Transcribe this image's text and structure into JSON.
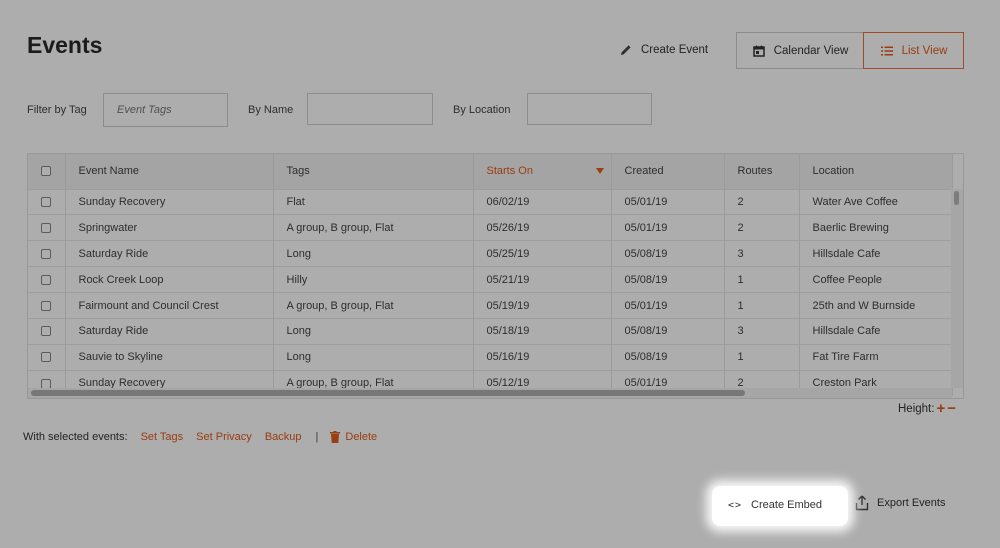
{
  "header": {
    "title": "Events",
    "create_event_label": "Create Event",
    "views": {
      "calendar_label": "Calendar View",
      "list_label": "List View",
      "active": "list"
    }
  },
  "filters": {
    "tag_label": "Filter by Tag",
    "tag_placeholder": "Event Tags",
    "name_label": "By Name",
    "name_value": "",
    "location_label": "By Location",
    "location_value": ""
  },
  "table": {
    "columns": [
      "Event Name",
      "Tags",
      "Starts On",
      "Created",
      "Routes",
      "Location"
    ],
    "sorted_column": "Starts On",
    "rows": [
      {
        "name": "Sunday Recovery",
        "tags": "Flat",
        "starts": "06/02/19",
        "created": "05/01/19",
        "routes": "2",
        "location": "Water Ave Coffee"
      },
      {
        "name": "Springwater",
        "tags": "A group, B group, Flat",
        "starts": "05/26/19",
        "created": "05/01/19",
        "routes": "2",
        "location": "Baerlic Brewing"
      },
      {
        "name": "Saturday Ride",
        "tags": "Long",
        "starts": "05/25/19",
        "created": "05/08/19",
        "routes": "3",
        "location": "Hillsdale Cafe"
      },
      {
        "name": "Rock Creek Loop",
        "tags": "Hilly",
        "starts": "05/21/19",
        "created": "05/08/19",
        "routes": "1",
        "location": "Coffee People"
      },
      {
        "name": "Fairmount and Council Crest",
        "tags": "A group, B group, Flat",
        "starts": "05/19/19",
        "created": "05/01/19",
        "routes": "1",
        "location": "25th and W Burnside"
      },
      {
        "name": "Saturday Ride",
        "tags": "Long",
        "starts": "05/18/19",
        "created": "05/08/19",
        "routes": "3",
        "location": "Hillsdale Cafe"
      },
      {
        "name": "Sauvie to Skyline",
        "tags": "Long",
        "starts": "05/16/19",
        "created": "05/08/19",
        "routes": "1",
        "location": "Fat Tire Farm"
      },
      {
        "name": "Sunday Recovery",
        "tags": "A group, B group, Flat",
        "starts": "05/12/19",
        "created": "05/01/19",
        "routes": "2",
        "location": "Creston Park"
      }
    ]
  },
  "height_control": {
    "label": "Height:",
    "plus": "+",
    "minus": "−"
  },
  "selected_actions": {
    "label": "With selected events:",
    "set_tags": "Set Tags",
    "set_privacy": "Set Privacy",
    "backup": "Backup",
    "separator": "|",
    "delete": "Delete"
  },
  "bottom_actions": {
    "embed_icon": "<>",
    "create_embed": "Create Embed",
    "export_events": "Export Events"
  },
  "colors": {
    "accent": "#e25a1c",
    "overlay": "rgba(0,0,0,0.32)"
  },
  "icons": [
    "pencil-icon",
    "calendar-icon",
    "list-icon",
    "code-icon",
    "export-icon",
    "trash-icon",
    "sort-desc-icon"
  ]
}
